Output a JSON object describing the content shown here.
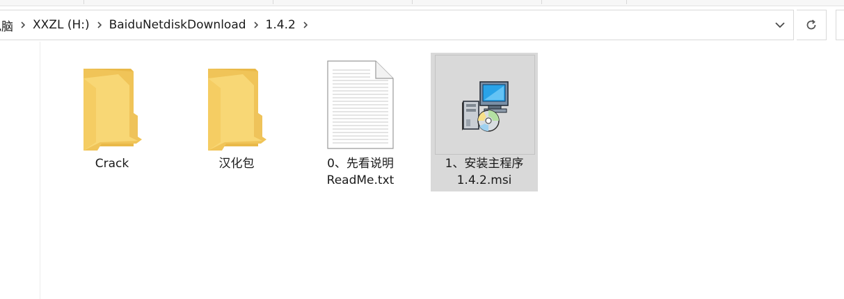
{
  "breadcrumb": {
    "items": [
      "电脑",
      "XXZL (H:)",
      "BaiduNetdiskDownload",
      "1.4.2"
    ]
  },
  "icons": {
    "separator": "chevron-right-icon",
    "dropdown": "chevron-down-icon",
    "refresh": "refresh-icon",
    "folder": "folder-icon",
    "text_file": "text-document-icon",
    "installer": "installer-msi-icon"
  },
  "files": [
    {
      "name_line1": "Crack",
      "name_line2": "",
      "type": "folder",
      "selected": false
    },
    {
      "name_line1": "汉化包",
      "name_line2": "",
      "type": "folder",
      "selected": false
    },
    {
      "name_line1": "0、先看说明",
      "name_line2": "ReadMe.txt",
      "type": "text",
      "selected": false
    },
    {
      "name_line1": "1、安装主程序",
      "name_line2": "1.4.2.msi",
      "type": "installer",
      "selected": true
    }
  ],
  "colors": {
    "selection": "#d9d9d9",
    "folder_front": "#f8d775",
    "folder_back": "#e9b949",
    "accent_blue": "#1e88e5"
  }
}
